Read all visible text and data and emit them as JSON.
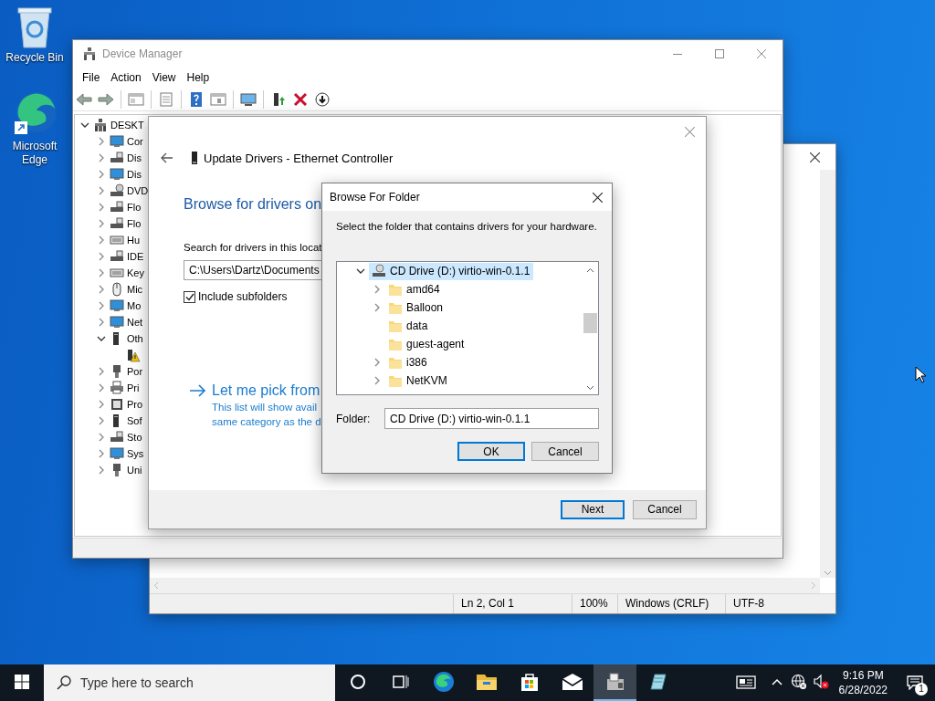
{
  "desktop_icons": [
    {
      "kind": "recycle",
      "label": "Recycle Bin"
    },
    {
      "kind": "edge",
      "label": "Microsoft Edge"
    }
  ],
  "notepad": {
    "status_bar": [
      "Ln 2, Col 1",
      "100%",
      "Windows (CRLF)",
      "UTF-8"
    ]
  },
  "device_manager": {
    "title": "Device Manager",
    "menu": [
      "File",
      "Action",
      "View",
      "Help"
    ],
    "toolbar": [
      {
        "kind": "back"
      },
      {
        "kind": "forward"
      },
      {
        "kind": "separator"
      },
      {
        "kind": "console"
      },
      {
        "kind": "separator"
      },
      {
        "kind": "properties"
      },
      {
        "kind": "separator"
      },
      {
        "kind": "help"
      },
      {
        "kind": "panel"
      },
      {
        "kind": "separator"
      },
      {
        "kind": "scan"
      },
      {
        "kind": "separator"
      },
      {
        "kind": "update"
      },
      {
        "kind": "uninstall"
      },
      {
        "kind": "download"
      }
    ],
    "tree": {
      "label": "DESKT",
      "kind": "computer",
      "expandable": true,
      "expanded": true,
      "children": [
        {
          "label": "Cor",
          "kind": "monitor",
          "expandable": true,
          "expanded": false
        },
        {
          "label": "Dis",
          "kind": "drive",
          "expandable": true,
          "expanded": false
        },
        {
          "label": "Dis",
          "kind": "monitor",
          "expandable": true,
          "expanded": false
        },
        {
          "label": "DVD",
          "kind": "disc",
          "expandable": true,
          "expanded": false
        },
        {
          "label": "Flo",
          "kind": "drive",
          "expandable": true,
          "expanded": false
        },
        {
          "label": "Flo",
          "kind": "drive",
          "expandable": true,
          "expanded": false
        },
        {
          "label": "Hu",
          "kind": "keyboard",
          "expandable": true,
          "expanded": false
        },
        {
          "label": "IDE",
          "kind": "drive",
          "expandable": true,
          "expanded": false
        },
        {
          "label": "Key",
          "kind": "keyboard",
          "expandable": true,
          "expanded": false
        },
        {
          "label": "Mic",
          "kind": "mouse",
          "expandable": true,
          "expanded": false
        },
        {
          "label": "Mo",
          "kind": "monitor",
          "expandable": true,
          "expanded": false
        },
        {
          "label": "Net",
          "kind": "monitor",
          "expandable": true,
          "expanded": false
        },
        {
          "label": "Oth",
          "kind": "tower",
          "expandable": true,
          "expanded": true,
          "children": [
            {
              "kind": "warning",
              "expandable": false
            }
          ]
        },
        {
          "label": "Por",
          "kind": "plug",
          "expandable": true,
          "expanded": false
        },
        {
          "label": "Pri",
          "kind": "printer",
          "expandable": true,
          "expanded": false
        },
        {
          "label": "Pro",
          "kind": "chip",
          "expandable": true,
          "expanded": false
        },
        {
          "label": "Sof",
          "kind": "tower",
          "expandable": true,
          "expanded": false
        },
        {
          "label": "Sto",
          "kind": "drive",
          "expandable": true,
          "expanded": false
        },
        {
          "label": "Sys",
          "kind": "monitor",
          "expandable": true,
          "expanded": false
        },
        {
          "label": "Uni",
          "kind": "plug",
          "expandable": true,
          "expanded": false
        }
      ]
    }
  },
  "update_drivers": {
    "title": "Update Drivers - Ethernet Controller",
    "heading": "Browse for drivers on",
    "search_label": "Search for drivers in this locat",
    "path": "C:\\Users\\Dartz\\Documents",
    "include_subfolders": {
      "label": "Include subfolders",
      "checked": true
    },
    "pick_link": {
      "title": "Let me pick from",
      "description": [
        "This list will show avail",
        "same category as the d"
      ]
    },
    "buttons": [
      {
        "label": "Next",
        "default": true
      },
      {
        "label": "Cancel",
        "default": false
      }
    ]
  },
  "browse_folder": {
    "title": "Browse For Folder",
    "instruction": "Select the folder that contains drivers for your hardware.",
    "tree": {
      "label": "CD Drive (D:) virtio-win-0.1.1",
      "kind": "cd-drive",
      "expandable": true,
      "expanded": true,
      "selected": true,
      "children": [
        {
          "label": "amd64",
          "kind": "folder",
          "expandable": true,
          "expanded": false,
          "selected": false
        },
        {
          "label": "Balloon",
          "kind": "folder",
          "expandable": true,
          "expanded": false,
          "selected": false
        },
        {
          "label": "data",
          "kind": "folder",
          "expandable": false,
          "selected": false
        },
        {
          "label": "guest-agent",
          "kind": "folder",
          "expandable": false,
          "selected": false
        },
        {
          "label": "i386",
          "kind": "folder",
          "expandable": true,
          "expanded": false,
          "selected": false
        },
        {
          "label": "NetKVM",
          "kind": "folder",
          "expandable": true,
          "expanded": false,
          "selected": false
        }
      ]
    },
    "folder_label": "Folder:",
    "folder_value": "CD Drive (D:) virtio-win-0.1.1",
    "buttons": [
      {
        "label": "OK",
        "default": true
      },
      {
        "label": "Cancel",
        "default": false
      }
    ]
  },
  "taskbar": {
    "search_placeholder": "Type here to search",
    "apps": [
      {
        "kind": "cortana",
        "active": false
      },
      {
        "kind": "task-view",
        "active": false
      },
      {
        "kind": "edge",
        "active": false
      },
      {
        "kind": "explorer",
        "active": false
      },
      {
        "kind": "store",
        "active": false
      },
      {
        "kind": "mail",
        "active": false
      },
      {
        "kind": "device-manager",
        "active": true
      },
      {
        "kind": "notepad",
        "active": false
      }
    ],
    "tray": [
      {
        "kind": "news"
      },
      {
        "kind": "chevron"
      },
      {
        "kind": "network"
      },
      {
        "kind": "volume-muted"
      }
    ],
    "time": "9:16 PM",
    "date": "6/28/2022",
    "notifications": "1"
  }
}
